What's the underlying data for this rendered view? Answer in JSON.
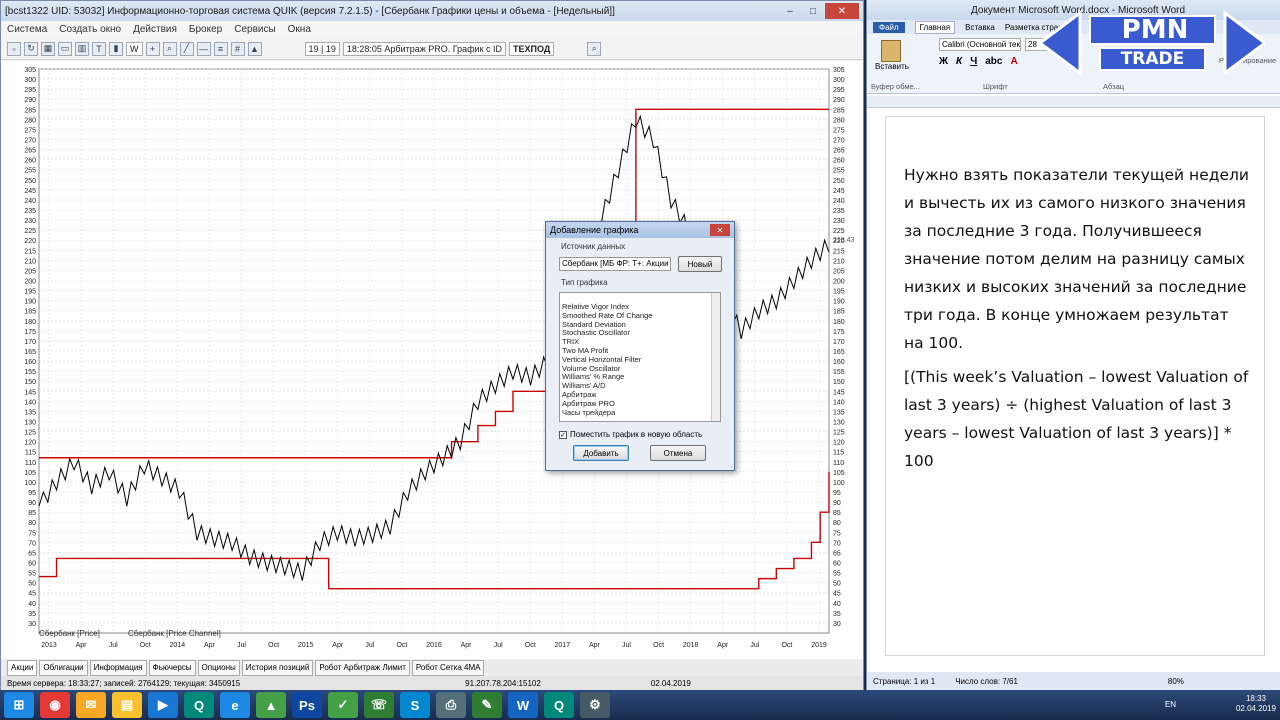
{
  "quik": {
    "title": "[bcst1322 UID: 53032] Информационно-торговая система QUIK (версия 7.2.1.5) - [Сбербанк Графики цены и объема - [Недельный]]",
    "menu": [
      "Система",
      "Создать окно",
      "Действия",
      "Брокер",
      "Сервисы",
      "Окна"
    ],
    "toolbar_period": "W",
    "toolbar_pages": "19 | 19",
    "toolbar_message": "18:28:05  Арбитраж PRO. График с ID",
    "toolbar_tech": "ТЕХПОД",
    "legend_price": "Сбербанк [Price]",
    "legend_channel": "Сбербанк [Price Channel]",
    "last_price_label": "218.43",
    "tabs": [
      "Акции",
      "Облигации",
      "Информация",
      "Фьючерсы",
      "Опционы",
      "История позиций",
      "Робот Арбитраж Лимит",
      "Робот Сетка 4МА"
    ],
    "status_server": "Время сервера: 18:33:27; записей: 2764129; текущая: 3450915",
    "status_ip": "91.207.78.204:15102",
    "status_date": "02.04.2019"
  },
  "chart_data": {
    "type": "line",
    "ylim": [
      25,
      305
    ],
    "y_ticks": [
      305,
      300,
      295,
      290,
      285,
      280,
      275,
      270,
      265,
      260,
      255,
      250,
      245,
      240,
      235,
      230,
      225,
      220,
      215,
      210,
      205,
      200,
      195,
      190,
      185,
      180,
      175,
      170,
      165,
      160,
      155,
      150,
      145,
      140,
      135,
      130,
      125,
      120,
      115,
      110,
      105,
      100,
      95,
      90,
      85,
      80,
      75,
      70,
      65,
      60,
      55,
      50,
      45,
      40,
      35,
      30
    ],
    "x_ticks": [
      "2013",
      "Apr",
      "Jul",
      "Oct",
      "2014",
      "Apr",
      "Jul",
      "Oct",
      "2015",
      "Apr",
      "Jul",
      "Oct",
      "2016",
      "Apr",
      "Jul",
      "Oct",
      "2017",
      "Apr",
      "Jul",
      "Oct",
      "2018",
      "Apr",
      "Jul",
      "Oct",
      "2019"
    ],
    "price_series": [
      [
        0,
        88
      ],
      [
        2,
        100
      ],
      [
        4,
        110
      ],
      [
        6,
        98
      ],
      [
        8,
        105
      ],
      [
        10,
        92
      ],
      [
        12,
        108
      ],
      [
        14,
        102
      ],
      [
        16,
        96
      ],
      [
        18,
        75
      ],
      [
        20,
        72
      ],
      [
        22,
        70
      ],
      [
        24,
        63
      ],
      [
        26,
        60
      ],
      [
        28,
        58
      ],
      [
        30,
        55
      ],
      [
        32,
        70
      ],
      [
        34,
        75
      ],
      [
        36,
        72
      ],
      [
        38,
        74
      ],
      [
        40,
        78
      ],
      [
        42,
        95
      ],
      [
        44,
        105
      ],
      [
        46,
        112
      ],
      [
        48,
        120
      ],
      [
        50,
        140
      ],
      [
        52,
        148
      ],
      [
        54,
        155
      ],
      [
        56,
        152
      ],
      [
        58,
        160
      ],
      [
        60,
        175
      ],
      [
        62,
        205
      ],
      [
        64,
        230
      ],
      [
        66,
        255
      ],
      [
        68,
        280
      ],
      [
        70,
        270
      ],
      [
        72,
        240
      ],
      [
        74,
        225
      ],
      [
        76,
        210
      ],
      [
        78,
        190
      ],
      [
        80,
        175
      ],
      [
        82,
        185
      ],
      [
        84,
        190
      ],
      [
        86,
        200
      ],
      [
        88,
        210
      ],
      [
        90,
        218
      ]
    ],
    "channel_upper": [
      [
        0,
        112
      ],
      [
        47,
        112
      ],
      [
        47,
        120
      ],
      [
        50,
        128
      ],
      [
        52,
        135
      ],
      [
        54,
        145
      ],
      [
        58,
        155
      ],
      [
        62,
        175
      ],
      [
        64,
        190
      ],
      [
        66,
        210
      ],
      [
        68,
        285
      ],
      [
        90,
        285
      ]
    ],
    "channel_lower": [
      [
        0,
        53
      ],
      [
        2,
        62
      ],
      [
        33,
        62
      ],
      [
        33,
        47
      ],
      [
        82,
        47
      ],
      [
        82,
        52
      ],
      [
        84,
        57
      ],
      [
        86,
        62
      ],
      [
        88,
        70
      ],
      [
        89,
        85
      ],
      [
        90,
        105
      ]
    ]
  },
  "dialog": {
    "title": "Добавление графика",
    "source_label": "Источник данных",
    "source_value": "Сбербанк [МБ ФР: Т+: Акции",
    "new_button": "Новый",
    "type_label": "Тип графика",
    "items": [
      "Relative Vigor Index",
      "Smoothed Rate Of Change",
      "Standard Deviation",
      "Stochastic Oscillator",
      "TRIX",
      "Two MA Profit",
      "Vertical Horizontal Filter",
      "Volume Oscillator",
      "Williams' % Range",
      "Williams' A/D",
      "Арбитраж",
      "Арбитраж PRO",
      "Часы трейдера"
    ],
    "checkbox_label": "Поместить график в новую область",
    "add_button": "Добавить",
    "cancel_button": "Отмена"
  },
  "word": {
    "title": "Документ Microsoft Word.docx - Microsoft Word",
    "tabs": [
      "Файл",
      "Главная",
      "Вставка",
      "Разметка страниц"
    ],
    "font_name": "Calibri (Основной тек",
    "font_size": "28",
    "paste_label": "Вставить",
    "clipboard_label": "Буфер обме...",
    "font_group": "Шрифт",
    "para_group": "Абзац",
    "editing_label": "Редактирование",
    "paragraph1": "Нужно взять показатели текущей недели и вычесть их из самого низкого значения за последние 3 года. Получившееся значение потом делим на разницу самых низких и высоких значений за последние три года. В конце умножаем результат на 100.",
    "paragraph2": "[(This week’s Valuation – lowest Valuation of last 3 years) ÷ (highest Valuation of last 3 years – lowest Valuation of last 3 years)] * 100",
    "status_page": "Страница: 1 из 1",
    "status_words": "Число слов: 7/61",
    "status_zoom": "80%"
  },
  "logo": {
    "line1": "PMN",
    "line2": "TRADE"
  },
  "taskbar": {
    "lang": "EN",
    "time": "18:33",
    "date": "02.04.2019",
    "icons": [
      {
        "label": "⊞",
        "color": "#1e88e5"
      },
      {
        "label": "◉",
        "color": "#e53935"
      },
      {
        "label": "✉",
        "color": "#f9a825"
      },
      {
        "label": "▤",
        "color": "#fbc02d"
      },
      {
        "label": "▶",
        "color": "#1976d2"
      },
      {
        "label": "Q",
        "color": "#00897b"
      },
      {
        "label": "e",
        "color": "#1e88e5"
      },
      {
        "label": "▲",
        "color": "#43a047"
      },
      {
        "label": "Ps",
        "color": "#0d47a1"
      },
      {
        "label": "✓",
        "color": "#43a047"
      },
      {
        "label": "☏",
        "color": "#2e7d32"
      },
      {
        "label": "S",
        "color": "#0288d1"
      },
      {
        "label": "⎙",
        "color": "#546e7a"
      },
      {
        "label": "✎",
        "color": "#2e7d32"
      },
      {
        "label": "W",
        "color": "#1565c0"
      },
      {
        "label": "Q",
        "color": "#00897b"
      },
      {
        "label": "⚙",
        "color": "#455a64"
      }
    ]
  },
  "colors": {
    "channel": "#cc0000",
    "price": "#000000",
    "accent": "#2a5ea8"
  }
}
